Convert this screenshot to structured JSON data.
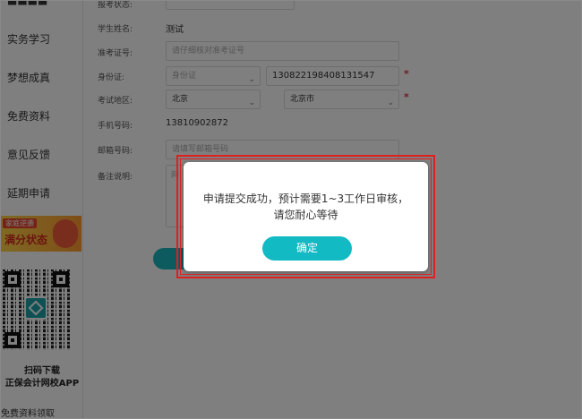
{
  "sidebar": {
    "items": [
      {
        "label": "实务学习"
      },
      {
        "label": "梦想成真"
      },
      {
        "label": "免费资料"
      },
      {
        "label": "意见反馈"
      },
      {
        "label": "延期申请"
      }
    ],
    "banner": {
      "small": "家庭逆袭",
      "big": "满分状态"
    },
    "qr_caption_1": "扫码下载",
    "qr_caption_2": "正保会计网校APP",
    "bottom_link": "免费资料领取"
  },
  "form": {
    "top_cut_label": "报考状态:",
    "student_name_label": "学生姓名:",
    "student_name_value": "测试",
    "ticket_label": "准考证号:",
    "ticket_placeholder": "请仔细核对准考证号",
    "id_label": "身份证:",
    "id_type_value": "身份证",
    "id_number_value": "130822198408131547",
    "region_label": "考试地区:",
    "province_value": "北京",
    "city_value": "北京市",
    "phone_label": "手机号码:",
    "phone_value": "13810902872",
    "email_label": "邮箱号码:",
    "email_placeholder": "请填写邮箱号码",
    "note_label": "备注说明:",
    "note_placeholder": "网",
    "required_mark": "*"
  },
  "modal": {
    "message_line1": "申请提交成功，预计需要1~3工作日审核，",
    "message_line2": "请您耐心等待",
    "ok_label": "确定"
  },
  "colors": {
    "accent": "#12bac4",
    "required": "#e0343a",
    "highlight_border": "#e02020"
  }
}
